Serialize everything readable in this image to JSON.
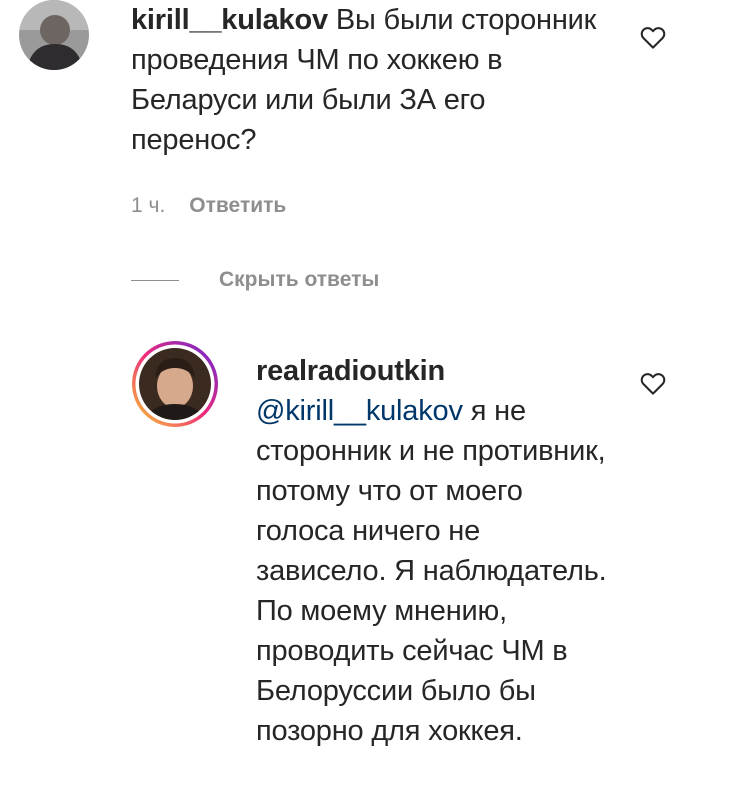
{
  "comment": {
    "username": "kirill__kulakov",
    "text": "Вы были сторонник проведения ЧМ по хоккею в Беларуси или были ЗА его перенос?",
    "time": "1 ч.",
    "reply_label": "Ответить",
    "like_icon": "heart-outline-icon"
  },
  "toggle_replies": {
    "label": "Скрыть ответы"
  },
  "reply": {
    "username": "realradioutkin",
    "mention": "@kirill__kulakov",
    "text": "я не сторонник и не противник, потому что от моего голоса ничего не зависело. Я наблюдатель. По моему мнению, проводить сейчас ЧМ в Белоруссии было бы позорно для хоккея.",
    "like_icon": "heart-outline-icon",
    "story_ring_colors": [
      "#f9ce34",
      "#ee2a7b",
      "#6228d7"
    ]
  }
}
